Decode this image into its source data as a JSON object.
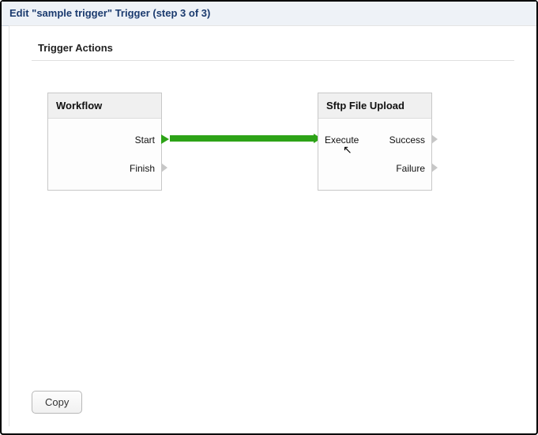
{
  "window": {
    "title": "Edit \"sample trigger\" Trigger (step 3 of 3)"
  },
  "section": {
    "title": "Trigger Actions"
  },
  "nodes": {
    "workflow": {
      "title": "Workflow",
      "ports": {
        "start": "Start",
        "finish": "Finish"
      }
    },
    "sftp": {
      "title": "Sftp File Upload",
      "ports": {
        "execute": "Execute",
        "success": "Success",
        "failure": "Failure"
      }
    }
  },
  "buttons": {
    "copy": "Copy"
  }
}
